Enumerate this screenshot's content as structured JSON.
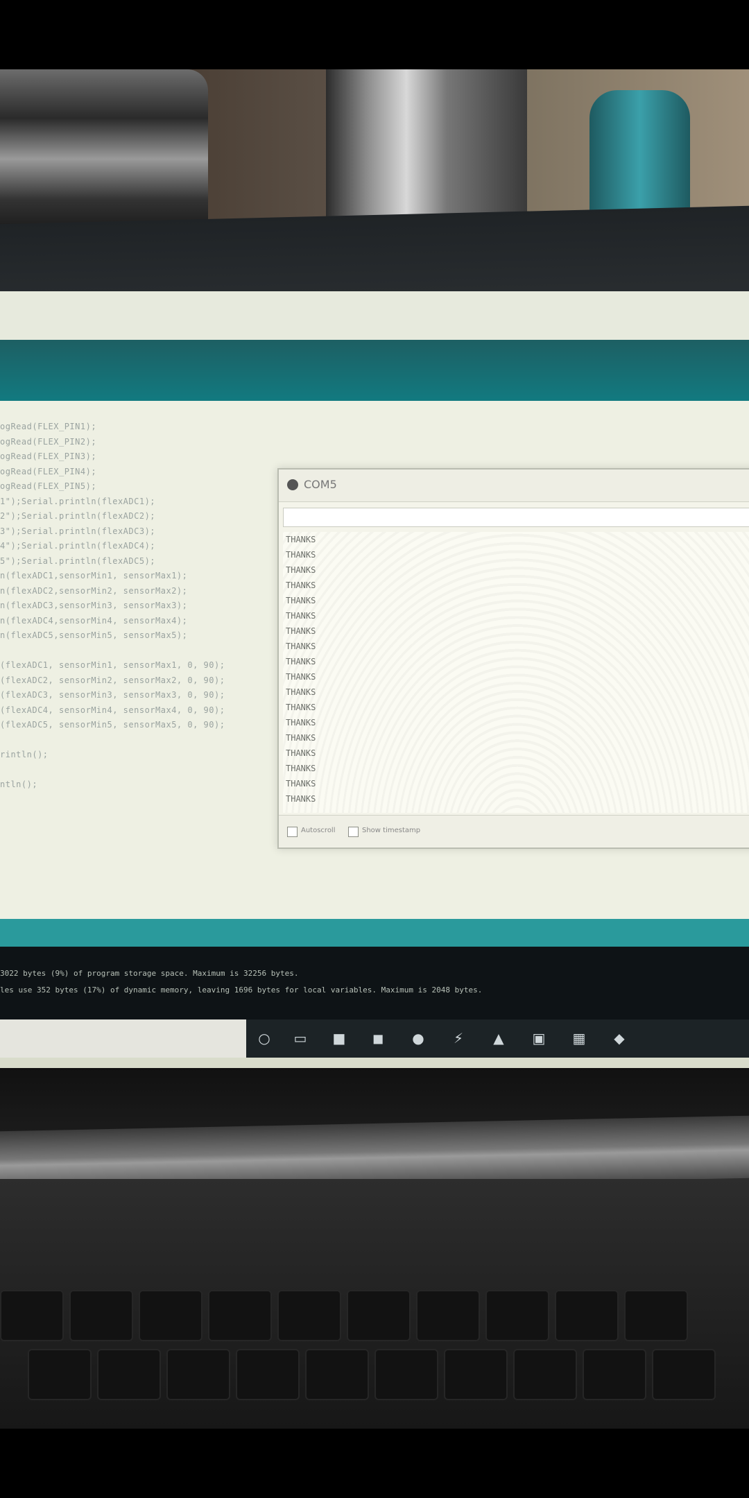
{
  "serial_monitor": {
    "title": "COM5",
    "output_lines": [
      "THANKS",
      "THANKS",
      "THANKS",
      "THANKS",
      "THANKS",
      "THANKS",
      "THANKS",
      "THANKS",
      "THANKS",
      "THANKS",
      "THANKS",
      "THANKS",
      "THANKS",
      "THANKS",
      "THANKS",
      "THANKS",
      "THANKS",
      "THANKS"
    ],
    "autoscroll_label": "Autoscroll",
    "timestamp_label": "Show timestamp"
  },
  "editor": {
    "code_lines": [
      "ogRead(FLEX_PIN1);",
      "ogRead(FLEX_PIN2);",
      "ogRead(FLEX_PIN3);",
      "ogRead(FLEX_PIN4);",
      "ogRead(FLEX_PIN5);",
      "1\");Serial.println(flexADC1);",
      "2\");Serial.println(flexADC2);",
      "3\");Serial.println(flexADC3);",
      "4\");Serial.println(flexADC4);",
      "5\");Serial.println(flexADC5);",
      "n(flexADC1,sensorMin1, sensorMax1);",
      "n(flexADC2,sensorMin2, sensorMax2);",
      "n(flexADC3,sensorMin3, sensorMax3);",
      "n(flexADC4,sensorMin4, sensorMax4);",
      "n(flexADC5,sensorMin5, sensorMax5);",
      "",
      "(flexADC1, sensorMin1, sensorMax1, 0, 90);",
      "(flexADC2, sensorMin2, sensorMax2, 0, 90);",
      "(flexADC3, sensorMin3, sensorMax3, 0, 90);",
      "(flexADC4, sensorMin4, sensorMax4, 0, 90);",
      "(flexADC5, sensorMin5, sensorMax5, 0, 90);",
      "",
      "rintln();",
      "",
      "ntln();"
    ]
  },
  "console": {
    "lines": [
      "3022 bytes (9%) of program storage space. Maximum is 32256 bytes.",
      "les use 352 bytes (17%) of dynamic memory, leaving 1696 bytes for local variables. Maximum is 2048 bytes."
    ]
  },
  "taskbar": {
    "icons": [
      "cortana-icon",
      "task-view-icon",
      "file-explorer-icon",
      "store-icon",
      "chrome-icon",
      "app-icon",
      "arduino-icon",
      "photos-icon",
      "app2-icon",
      "app3-icon"
    ]
  }
}
